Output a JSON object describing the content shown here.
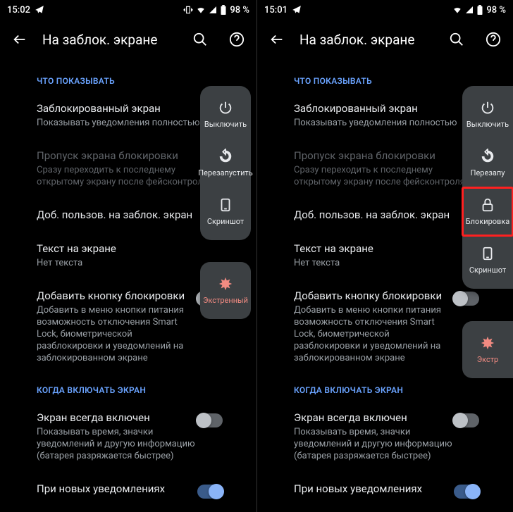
{
  "left": {
    "status": {
      "time": "15:02",
      "battery": "98 %"
    },
    "header": {
      "title": "На заблок. экране"
    },
    "sec_show": "ЧТО ПОКАЗЫВАТЬ",
    "items": {
      "locked": {
        "title": "Заблокированный экран",
        "sub": "Показывать уведомления полностью"
      },
      "skip": {
        "title": "Пропуск экрана блокировки",
        "sub": "Сразу переходить к последнему открытому экрану после фейсконтроля"
      },
      "users": {
        "title": "Доб. пользов. на заблок. экран"
      },
      "text": {
        "title": "Текст на экране",
        "sub": "Нет текста"
      },
      "lockbtn": {
        "title": "Добавить кнопку блокировки",
        "sub": "Добавить в меню кнопки питания возможность отключения Smart Lock, биометрической разблокировки и уведомлений на заблокированном экране"
      }
    },
    "sec_when": "КОГДА ВКЛЮЧАТЬ ЭКРАН",
    "items2": {
      "aod": {
        "title": "Экран всегда включен",
        "sub": "Показывать время, значки уведомлений и другую информацию (батарея разряжается быстрее)"
      },
      "notif": {
        "title": "При новых уведомлениях"
      }
    },
    "power": {
      "off": "Выключить",
      "restart": "Перезапустить",
      "shot": "Скриншот",
      "emerg": "Экстренный"
    }
  },
  "right": {
    "status": {
      "time": "15:01",
      "battery": "98 %"
    },
    "header": {
      "title": "На заблок. экране"
    },
    "sec_show": "ЧТО ПОКАЗЫВАТЬ",
    "items": {
      "locked": {
        "title": "Заблокированный экран",
        "sub": "Показывать уведомления полностью"
      },
      "skip": {
        "title": "Пропуск экрана блокировки",
        "sub": "Сразу переходить к последнему открытому экрану после фейсконтроля"
      },
      "users": {
        "title": "Доб. пользов. на заблок. экран"
      },
      "text": {
        "title": "Текст на экране",
        "sub": "Нет текста"
      },
      "lockbtn": {
        "title": "Добавить кнопку блокировки",
        "sub": "Добавить в меню кнопки питания возможность отключения Smart Lock, биометрической разблокировки и уведомлений на заблокированном экране"
      }
    },
    "sec_when": "КОГДА ВКЛЮЧАТЬ ЭКРАН",
    "items2": {
      "aod": {
        "title": "Экран всегда включен",
        "sub": "Показывать время, значки уведомлений и другую информацию (батарея разряжается быстрее)"
      },
      "notif": {
        "title": "При новых уведомлениях"
      }
    },
    "power": {
      "off": "Выключить",
      "restart": "Перезапу",
      "lock": "Блокировка",
      "shot": "Скриншот",
      "emerg": "Экстр"
    }
  }
}
